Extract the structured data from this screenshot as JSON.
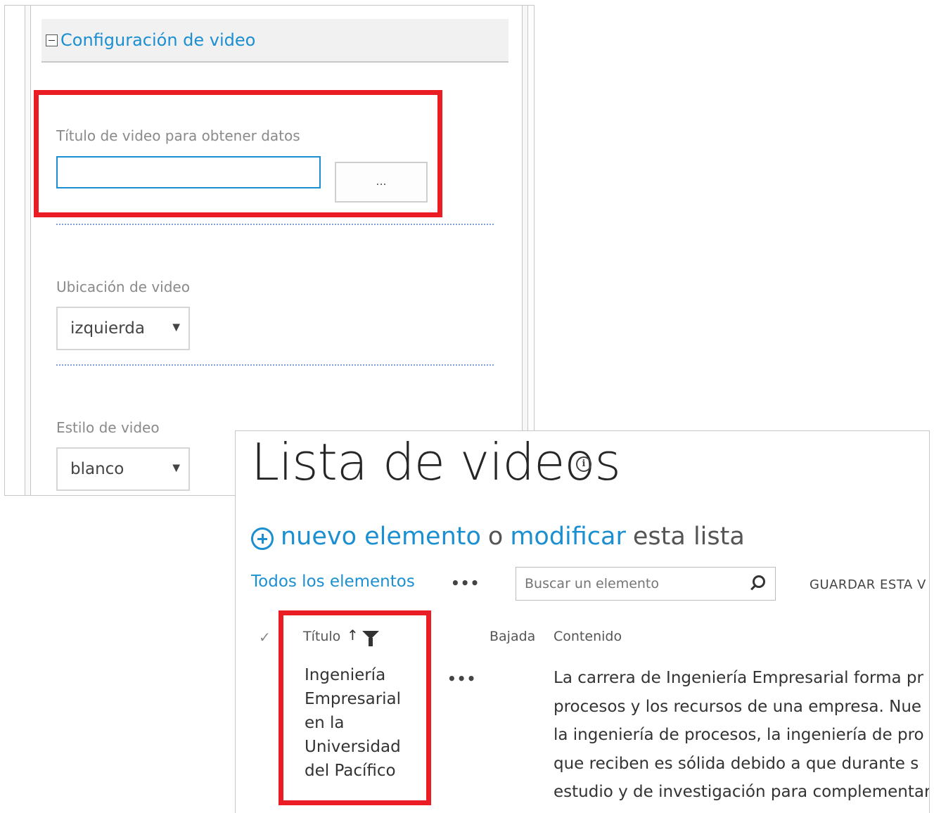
{
  "config": {
    "section_title": "Configuración de video",
    "video_title": {
      "label": "Título de video para obtener datos",
      "value": "",
      "button_label": "..."
    },
    "video_location": {
      "label": "Ubicación de video",
      "selected": "izquierda"
    },
    "video_style": {
      "label": "Estilo de video",
      "selected": "blanco"
    }
  },
  "list": {
    "title": "Lista de videos",
    "info_icon": "info-icon",
    "new_item": "nuevo elemento",
    "or_text": "o",
    "modify": "modificar",
    "this_list": "esta lista",
    "view_label": "Todos los elementos",
    "more": "•••",
    "search_placeholder": "Buscar un elemento",
    "save_view": "GUARDAR ESTA V",
    "columns": {
      "title": "Título",
      "summary": "Bajada",
      "content": "Contenido"
    },
    "rows": [
      {
        "title": "Ingeniería Empresarial en la Universidad del Pacífico",
        "title_lines": [
          "Ingeniería",
          "Empresarial",
          "en la",
          "Universidad",
          "del Pacífico"
        ],
        "content_lines": [
          "La carrera de Ingeniería Empresarial forma pr",
          "procesos y los recursos de una empresa. Nue",
          "la ingeniería de procesos, la ingeniería de pro",
          "que reciben es sólida debido a que durante s",
          "estudio y de investigación para complementar"
        ]
      }
    ]
  },
  "colors": {
    "accent": "#1c8fd1",
    "highlight": "#ea1c24"
  }
}
